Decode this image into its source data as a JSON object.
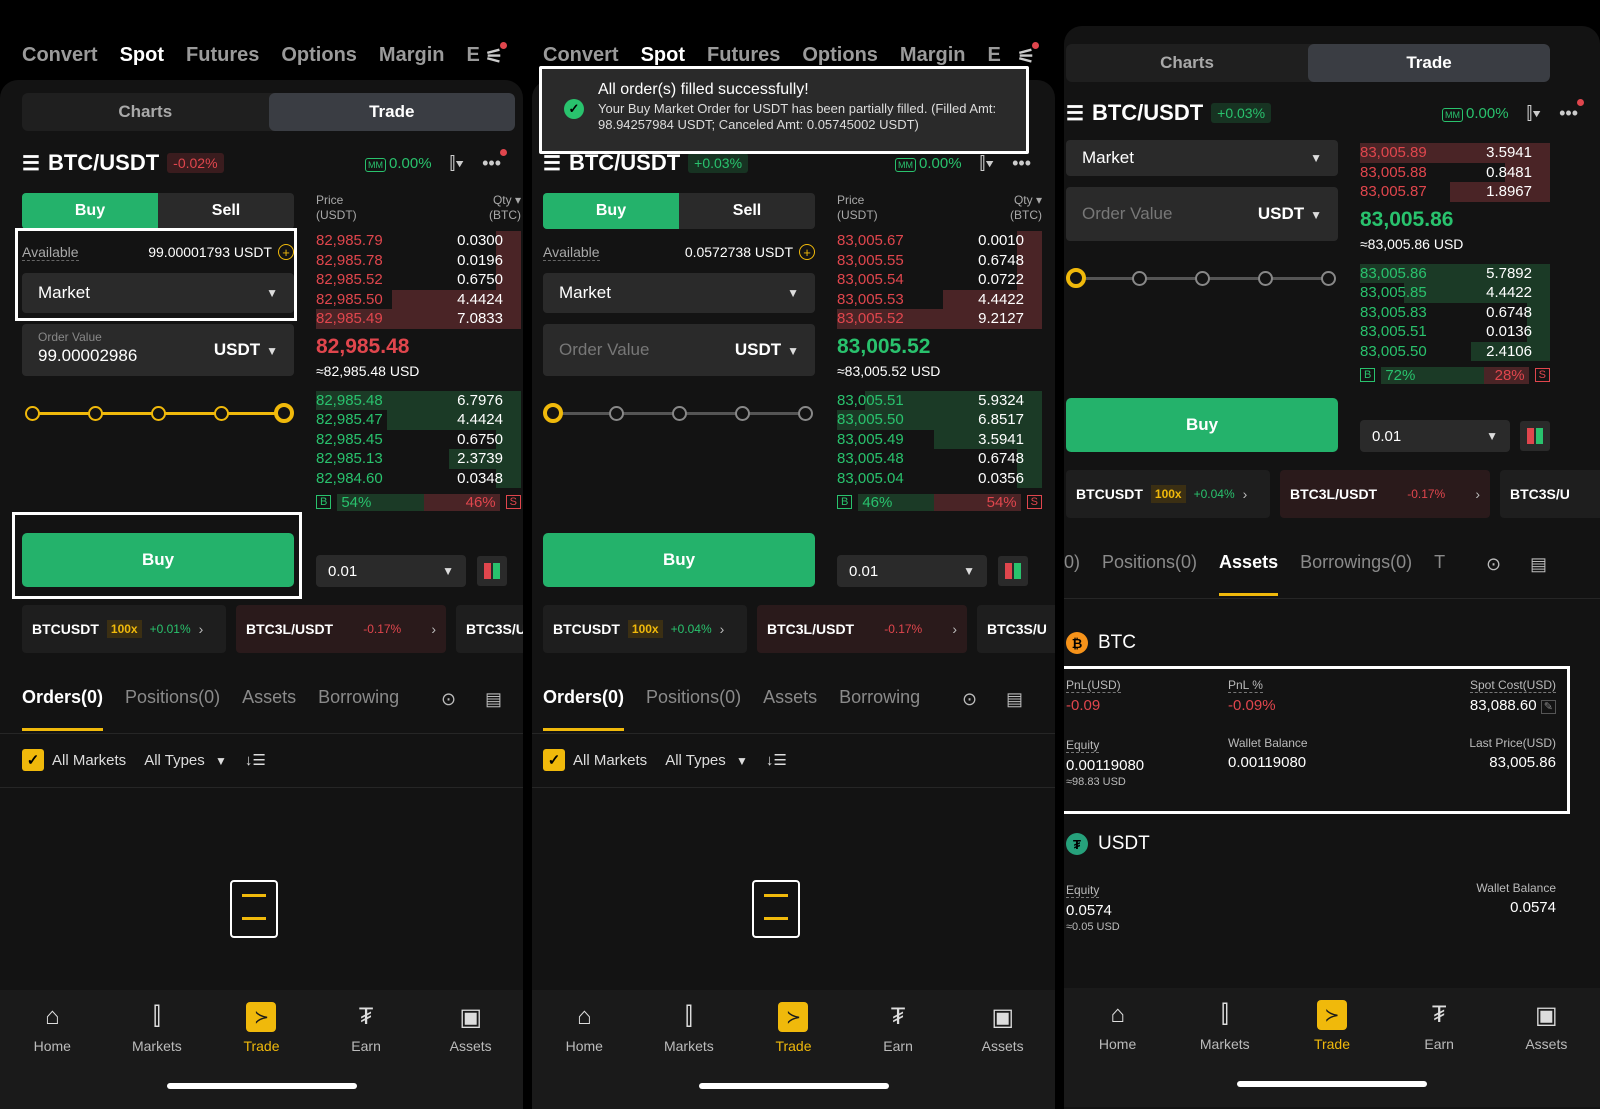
{
  "top_tabs": [
    "Convert",
    "Spot",
    "Futures",
    "Options",
    "Margin",
    "E"
  ],
  "mode_tabs": {
    "charts": "Charts",
    "trade": "Trade"
  },
  "bottom_nav": [
    {
      "label": "Home",
      "icon": "home-icon",
      "glyph": "⌂"
    },
    {
      "label": "Markets",
      "icon": "markets-icon",
      "glyph": "⫿"
    },
    {
      "label": "Trade",
      "icon": "trade-icon",
      "glyph": "≻"
    },
    {
      "label": "Earn",
      "icon": "earn-icon",
      "glyph": "₮"
    },
    {
      "label": "Assets",
      "icon": "assets-icon",
      "glyph": "▣"
    }
  ],
  "colors": {
    "accent": "#f0b90b",
    "buy": "#24b26b",
    "sell": "#e0464d",
    "bg": "#131313"
  },
  "panel1": {
    "pair": "BTC/USDT",
    "change": "-0.02%",
    "mm": "MM",
    "mm_pct": "0.00%",
    "buy": "Buy",
    "sell": "Sell",
    "available_label": "Available",
    "available_value": "99.00001793 USDT",
    "order_type": "Market",
    "order_value_label": "Order Value",
    "order_value": "99.00002986",
    "order_unit": "USDT",
    "slider_pct": 100,
    "price_hdr": "Price",
    "price_unit": "(USDT)",
    "qty_hdr": "Qty",
    "qty_unit": "(BTC)",
    "asks": [
      [
        "82,985.79",
        "0.0300"
      ],
      [
        "82,985.78",
        "0.0196"
      ],
      [
        "82,985.52",
        "0.6750"
      ],
      [
        "82,985.50",
        "4.4424"
      ],
      [
        "82,985.49",
        "7.0833"
      ]
    ],
    "last": "82,985.48",
    "last_usd": "≈82,985.48 USD",
    "bids": [
      [
        "82,985.48",
        "6.7976"
      ],
      [
        "82,985.47",
        "4.4424"
      ],
      [
        "82,985.45",
        "0.6750"
      ],
      [
        "82,985.13",
        "2.3739"
      ],
      [
        "82,984.60",
        "0.0348"
      ]
    ],
    "b_label": "B",
    "b_pct": "54%",
    "s_pct": "46%",
    "s_label": "S",
    "buy_button": "Buy",
    "qty_select": "0.01",
    "tickers": [
      {
        "name": "BTCUSDT",
        "lev": "100x",
        "pct": "+0.01%"
      },
      {
        "name": "BTC3L/USDT",
        "lev": "",
        "pct": "-0.17%"
      },
      {
        "name": "BTC3S/U",
        "lev": "",
        "pct": ""
      }
    ],
    "tabs": [
      "Orders(0)",
      "Positions(0)",
      "Assets",
      "Borrowing"
    ],
    "filter_all_markets": "All Markets",
    "filter_all_types": "All Types"
  },
  "panel2": {
    "pair": "BTC/USDT",
    "change": "+0.03%",
    "mm": "MM",
    "mm_pct": "0.00%",
    "toast_title": "All order(s) filled successfully!",
    "toast_body": "Your Buy Market Order for USDT has been partially filled. (Filled Amt: 98.94257984 USDT; Canceled Amt: 0.05745002 USDT)",
    "buy": "Buy",
    "sell": "Sell",
    "available_label": "Available",
    "available_value": "0.0572738 USDT",
    "order_type": "Market",
    "order_value_placeholder": "Order Value",
    "order_unit": "USDT",
    "slider_pct": 0,
    "price_hdr": "Price",
    "price_unit": "(USDT)",
    "qty_hdr": "Qty",
    "qty_unit": "(BTC)",
    "asks": [
      [
        "83,005.67",
        "0.0010"
      ],
      [
        "83,005.55",
        "0.6748"
      ],
      [
        "83,005.54",
        "0.0722"
      ],
      [
        "83,005.53",
        "4.4422"
      ],
      [
        "83,005.52",
        "9.2127"
      ]
    ],
    "last": "83,005.52",
    "last_usd": "≈83,005.52 USD",
    "bids": [
      [
        "83,005.51",
        "5.9324"
      ],
      [
        "83,005.50",
        "6.8517"
      ],
      [
        "83,005.49",
        "3.5941"
      ],
      [
        "83,005.48",
        "0.6748"
      ],
      [
        "83,005.04",
        "0.0356"
      ]
    ],
    "b_label": "B",
    "b_pct": "46%",
    "s_pct": "54%",
    "s_label": "S",
    "buy_button": "Buy",
    "qty_select": "0.01",
    "tickers": [
      {
        "name": "BTCUSDT",
        "lev": "100x",
        "pct": "+0.04%"
      },
      {
        "name": "BTC3L/USDT",
        "lev": "",
        "pct": "-0.17%"
      },
      {
        "name": "BTC3S/U",
        "lev": "",
        "pct": ""
      }
    ],
    "tabs": [
      "Orders(0)",
      "Positions(0)",
      "Assets",
      "Borrowing"
    ],
    "filter_all_markets": "All Markets",
    "filter_all_types": "All Types"
  },
  "panel3": {
    "pair": "BTC/USDT",
    "change": "+0.03%",
    "mm": "MM",
    "mm_pct": "0.00%",
    "order_type": "Market",
    "order_value_placeholder": "Order Value",
    "order_unit": "USDT",
    "slider_pct": 0,
    "asks": [
      [
        "83,005.89",
        "3.5941"
      ],
      [
        "83,005.88",
        "0.8481"
      ],
      [
        "83,005.87",
        "1.8967"
      ]
    ],
    "last": "83,005.86",
    "last_usd": "≈83,005.86 USD",
    "bids": [
      [
        "83,005.86",
        "5.7892"
      ],
      [
        "83,005.85",
        "4.4422"
      ],
      [
        "83,005.83",
        "0.6748"
      ],
      [
        "83,005.51",
        "0.0136"
      ],
      [
        "83,005.50",
        "2.4106"
      ]
    ],
    "b_label": "B",
    "b_pct": "72%",
    "s_pct": "28%",
    "s_label": "S",
    "buy_button": "Buy",
    "qty_select": "0.01",
    "tickers": [
      {
        "name": "BTCUSDT",
        "lev": "100x",
        "pct": "+0.04%"
      },
      {
        "name": "BTC3L/USDT",
        "lev": "",
        "pct": "-0.17%"
      },
      {
        "name": "BTC3S/U",
        "lev": "",
        "pct": ""
      }
    ],
    "tabs": [
      "(0)",
      "Positions(0)",
      "Assets",
      "Borrowings(0)",
      "T"
    ],
    "btc": {
      "name": "BTC",
      "pnl_label": "PnL(USD)",
      "pnl": "-0.09",
      "pnlp_label": "PnL %",
      "pnlp": "-0.09%",
      "cost_label": "Spot Cost(USD)",
      "cost": "83,088.60",
      "equity_label": "Equity",
      "equity": "0.00119080",
      "equity_usd": "≈98.83 USD",
      "wallet_label": "Wallet Balance",
      "wallet": "0.00119080",
      "last_label": "Last Price(USD)",
      "last": "83,005.86"
    },
    "usdt": {
      "name": "USDT",
      "equity_label": "Equity",
      "equity": "0.0574",
      "equity_usd": "≈0.05 USD",
      "wallet_label": "Wallet Balance",
      "wallet": "0.0574"
    }
  }
}
